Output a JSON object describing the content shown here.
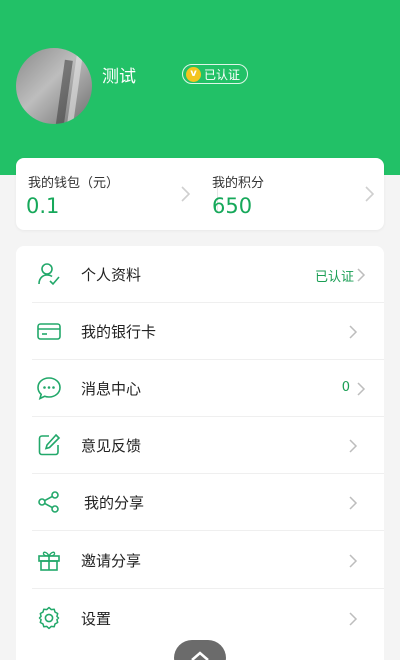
{
  "profile": {
    "name": "测试",
    "badge_label": "已认证",
    "badge_icon": "v",
    "accent": "#22c167"
  },
  "wallet": {
    "wallet_label": "我的钱包（元）",
    "wallet_value": "0.1",
    "points_label": "我的积分",
    "points_value": "650"
  },
  "menu": {
    "items": [
      {
        "label": "个人资料",
        "icon": "user-check-icon",
        "value": "已认证"
      },
      {
        "label": "我的银行卡",
        "icon": "bank-card-icon",
        "value": ""
      },
      {
        "label": "消息中心",
        "icon": "message-icon",
        "value": "0"
      },
      {
        "label": "意见反馈",
        "icon": "edit-feedback-icon",
        "value": ""
      },
      {
        "label": "我的分享",
        "icon": "share-icon",
        "value": ""
      },
      {
        "label": "邀请分享",
        "icon": "gift-icon",
        "value": ""
      },
      {
        "label": "设置",
        "icon": "gear-icon",
        "value": ""
      }
    ]
  }
}
